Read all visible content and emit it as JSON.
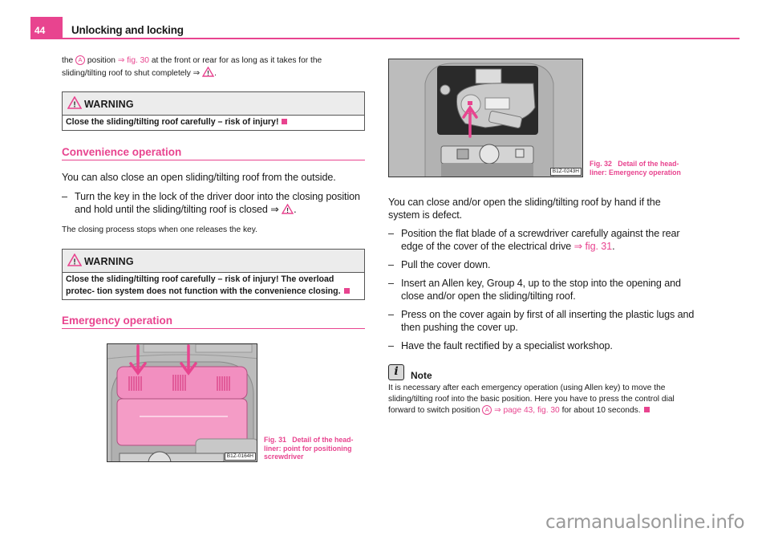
{
  "header": {
    "page_number": "44",
    "title": "Unlocking and locking"
  },
  "colors": {
    "accent": "#e8448f",
    "warning_header_bg": "#ececec",
    "watermark": "#9a9a9a"
  },
  "intro": {
    "part1": "the",
    "marker": "A",
    "part2": "position",
    "arrow": "⇒",
    "link": "fig. 30",
    "part3": "at the front or rear for as long as it takes for the",
    "line2": "sliding/tilting roof to shut completely",
    "line2_end": "."
  },
  "warning1": {
    "label": "WARNING",
    "text": "Close the sliding/tilting roof carefully – risk of injury!"
  },
  "convenience": {
    "title": "Convenience operation",
    "paragraph": "You can also close an open sliding/tilting roof from the outside.",
    "bullets": [
      {
        "dash": "–",
        "text": "Turn the key in the lock of the driver door into the closing position and hold until the sliding/tilting roof is closed"
      }
    ],
    "note_small": "The closing process stops when one releases the key."
  },
  "warning2": {
    "label": "WARNING",
    "text": "Close the sliding/tilting roof carefully – risk of injury! The overload protec- tion system does not function with the convenience closing."
  },
  "emergency": {
    "title": "Emergency operation"
  },
  "figure31": {
    "code": "B1Z-0164H",
    "caption_num": "Fig. 31",
    "caption_text": "Detail of the head- liner: point for positioning screwdriver"
  },
  "figure32": {
    "code": "B1Z-0243H",
    "caption_num": "Fig. 32",
    "caption_text": "Detail of the head- liner: Emergency operation"
  },
  "right": {
    "paragraph": "You can close and/or open the sliding/tilting roof by hand if the system is defect.",
    "bullets": [
      {
        "dash": "–",
        "text": "Position the flat blade of a screwdriver carefully against the rear edge of the cover of the electrical drive",
        "link": "fig. 31",
        "end": "."
      },
      {
        "dash": "–",
        "text": "Pull the cover down."
      },
      {
        "dash": "–",
        "text": "Insert an Allen key, Group 4, up to the stop into the opening and close and/or open the sliding/tilting roof."
      },
      {
        "dash": "–",
        "text": "Press on the cover again by first of all inserting the plastic lugs and then pushing the cover up."
      },
      {
        "dash": "–",
        "text": "Have the fault rectified by a specialist workshop."
      }
    ]
  },
  "note": {
    "icon": "i",
    "label": "Note",
    "text1": "It is necessary after each emergency operation (using Allen key) to move the sliding/tilting roof into the basic position. Here you have to press the control dial forward to switch position",
    "marker": "A",
    "arrow": "⇒",
    "link": "page 43, fig. 30",
    "text2": "for about 10 seconds."
  },
  "watermark": "carmanualsonline.info"
}
